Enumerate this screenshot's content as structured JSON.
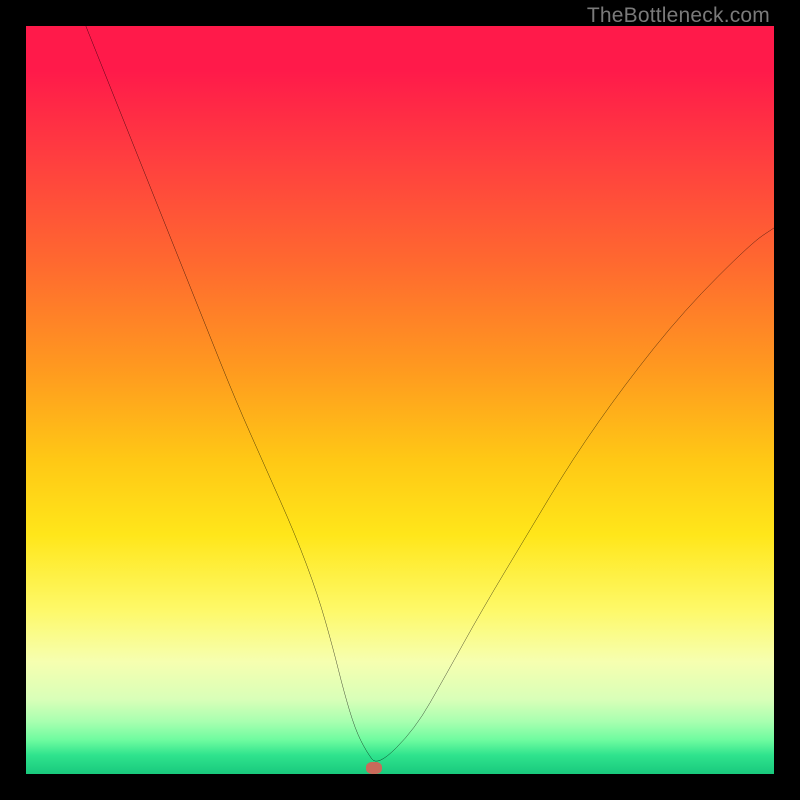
{
  "watermark": "TheBottleneck.com",
  "chart_data": {
    "type": "line",
    "title": "",
    "xlabel": "",
    "ylabel": "",
    "xlim": [
      0,
      100
    ],
    "ylim": [
      0,
      100
    ],
    "grid": false,
    "series": [
      {
        "name": "bottleneck-curve",
        "x": [
          8,
          12,
          16,
          20,
          24,
          28,
          32,
          36,
          39,
          41,
          42.5,
          44,
          45.5,
          47,
          52,
          56,
          61,
          67,
          73,
          80,
          88,
          97,
          100
        ],
        "y": [
          100,
          90,
          80,
          70,
          60,
          50,
          41,
          32,
          24,
          17,
          11,
          6,
          3,
          1,
          6,
          13,
          22,
          32,
          42,
          52,
          62,
          71,
          73
        ]
      }
    ],
    "marker": {
      "x": 46.5,
      "y": 0.8,
      "color": "#c96a5a"
    },
    "background_gradient": {
      "stops": [
        {
          "pos": 0.0,
          "color": "#ff1a4a"
        },
        {
          "pos": 0.3,
          "color": "#ff6a2f"
        },
        {
          "pos": 0.6,
          "color": "#ffe61a"
        },
        {
          "pos": 0.88,
          "color": "#f6ffb0"
        },
        {
          "pos": 1.0,
          "color": "#19c97d"
        }
      ]
    }
  }
}
